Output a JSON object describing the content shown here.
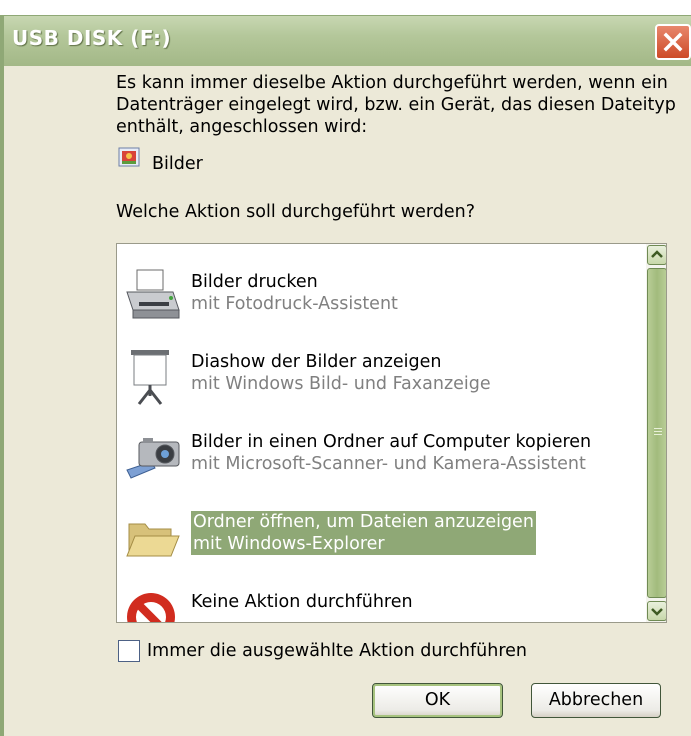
{
  "window": {
    "title": "USB DISK (F:)"
  },
  "description": "Es kann immer dieselbe Aktion durchgeführt werden, wenn ein Datenträger eingelegt wird, bzw. ein Gerät, das diesen Dateityp enthält, angeschlossen wird:",
  "content_type": {
    "label": "Bilder",
    "icon": "pictures-icon"
  },
  "question": "Welche Aktion soll durchgeführt werden?",
  "actions": [
    {
      "title": "Bilder drucken",
      "subtitle": "mit Fotodruck-Assistent",
      "icon": "printer-icon",
      "selected": false
    },
    {
      "title": "Diashow der Bilder anzeigen",
      "subtitle": "mit Windows Bild- und Faxanzeige",
      "icon": "projector-screen-icon",
      "selected": false
    },
    {
      "title": "Bilder in einen Ordner auf Computer kopieren",
      "subtitle": "mit Microsoft-Scanner- und Kamera-Assistent",
      "icon": "camera-icon",
      "selected": false
    },
    {
      "title": "Ordner öffnen, um Dateien anzuzeigen",
      "subtitle": "mit Windows-Explorer",
      "icon": "folder-icon",
      "selected": true
    },
    {
      "title": "Keine Aktion durchführen",
      "subtitle": "",
      "icon": "no-action-icon",
      "selected": false
    }
  ],
  "always_checkbox": {
    "label": "Immer die ausgewählte Aktion durchführen",
    "checked": false
  },
  "buttons": {
    "ok": "OK",
    "cancel": "Abbrechen"
  },
  "colors": {
    "titlebar": "#a3b887",
    "selection": "#8fa876",
    "dialog_bg": "#ece9d8",
    "close_button": "#cd4a27"
  }
}
